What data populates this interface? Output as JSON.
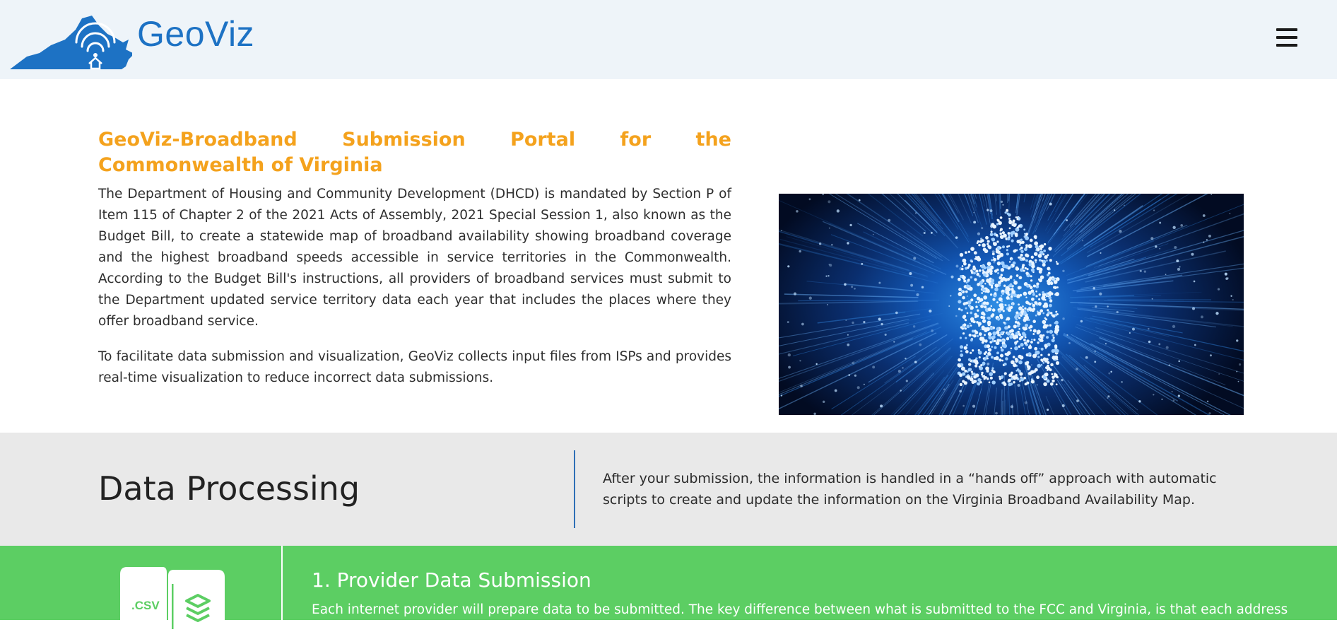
{
  "header": {
    "brand": "GeoViz",
    "logo_icon": "virginia-wifi-home-logo",
    "menu_icon": "hamburger-menu-icon"
  },
  "intro": {
    "title": "GeoViz-Broadband Submission Portal for the Commonwealth of Virginia",
    "paragraph1": "The Department of Housing and Community Development (DHCD) is mandated by Section P of Item 115 of Chapter 2 of the 2021 Acts of Assembly, 2021 Special Session 1, also known as the Budget Bill, to create a statewide map of broadband availability showing broadband coverage and the highest broadband speeds accessible in service territories in the Commonwealth. According to the Budget Bill's instructions, all providers of broadband services must submit to the Department updated service territory data each year that includes the places where they offer broadband service.",
    "paragraph2": "To facilitate data submission and visualization, GeoViz collects input files from ISPs and provides real-time visualization to reduce incorrect data submissions."
  },
  "data_processing": {
    "title": "Data Processing",
    "text": "After your submission, the information is handled in a “hands off” approach with automatic scripts to create and update the information on the Virginia Broadband Availability Map."
  },
  "steps": [
    {
      "title": "1. Provider Data Submission",
      "text": "Each internet provider will prepare data to be submitted. The key difference between what is submitted to the FCC and Virginia, is that each address",
      "file_label": ".CSV"
    }
  ],
  "colors": {
    "accent_blue": "#1d72c4",
    "title_orange": "#f4a21d",
    "band_gray": "#e9e9e9",
    "band_green": "#5cce63"
  }
}
